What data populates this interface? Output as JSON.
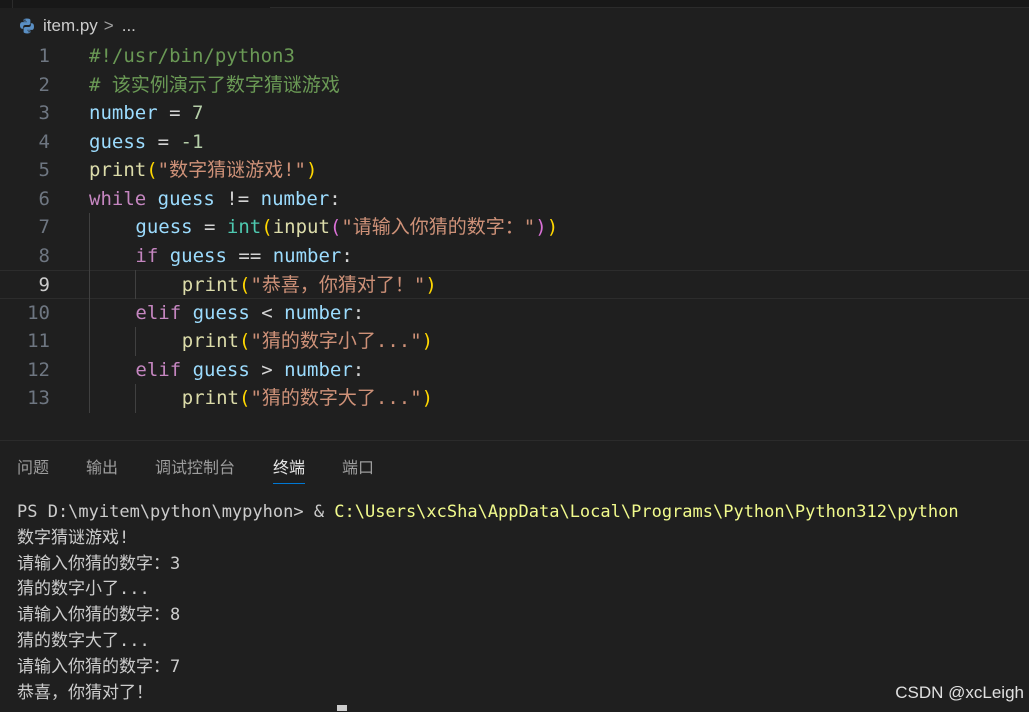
{
  "breadcrumb": {
    "file": "item.py",
    "chevron": ">",
    "ellipsis": "..."
  },
  "editor": {
    "active_line": 9,
    "lines": [
      {
        "n": "1",
        "indent": 0,
        "tokens": [
          {
            "t": "#!/usr/bin/python3",
            "c": "comment"
          }
        ]
      },
      {
        "n": "2",
        "indent": 0,
        "tokens": [
          {
            "t": "# 该实例演示了数字猜谜游戏",
            "c": "comment"
          }
        ]
      },
      {
        "n": "3",
        "indent": 0,
        "tokens": [
          {
            "t": "number",
            "c": "var"
          },
          {
            "t": " = ",
            "c": "op"
          },
          {
            "t": "7",
            "c": "num"
          }
        ]
      },
      {
        "n": "4",
        "indent": 0,
        "tokens": [
          {
            "t": "guess",
            "c": "var"
          },
          {
            "t": " = ",
            "c": "op"
          },
          {
            "t": "-1",
            "c": "num"
          }
        ]
      },
      {
        "n": "5",
        "indent": 0,
        "tokens": [
          {
            "t": "print",
            "c": "fn"
          },
          {
            "t": "(",
            "c": "p1"
          },
          {
            "t": "\"数字猜谜游戏!\"",
            "c": "str"
          },
          {
            "t": ")",
            "c": "p1"
          }
        ]
      },
      {
        "n": "6",
        "indent": 0,
        "tokens": [
          {
            "t": "while",
            "c": "kw"
          },
          {
            "t": " ",
            "c": "op"
          },
          {
            "t": "guess",
            "c": "var"
          },
          {
            "t": " != ",
            "c": "op"
          },
          {
            "t": "number",
            "c": "var"
          },
          {
            "t": ":",
            "c": "op"
          }
        ]
      },
      {
        "n": "7",
        "indent": 1,
        "tokens": [
          {
            "t": "guess",
            "c": "var"
          },
          {
            "t": " = ",
            "c": "op"
          },
          {
            "t": "int",
            "c": "type"
          },
          {
            "t": "(",
            "c": "p1"
          },
          {
            "t": "input",
            "c": "fn"
          },
          {
            "t": "(",
            "c": "p2"
          },
          {
            "t": "\"请输入你猜的数字：\"",
            "c": "str"
          },
          {
            "t": ")",
            "c": "p2"
          },
          {
            "t": ")",
            "c": "p1"
          }
        ]
      },
      {
        "n": "8",
        "indent": 1,
        "tokens": [
          {
            "t": "if",
            "c": "kw"
          },
          {
            "t": " ",
            "c": "op"
          },
          {
            "t": "guess",
            "c": "var"
          },
          {
            "t": " == ",
            "c": "op"
          },
          {
            "t": "number",
            "c": "var"
          },
          {
            "t": ":",
            "c": "op"
          }
        ]
      },
      {
        "n": "9",
        "indent": 2,
        "tokens": [
          {
            "t": "print",
            "c": "fn"
          },
          {
            "t": "(",
            "c": "p1"
          },
          {
            "t": "\"恭喜，你猜对了！\"",
            "c": "str"
          },
          {
            "t": ")",
            "c": "p1"
          }
        ]
      },
      {
        "n": "10",
        "indent": 1,
        "tokens": [
          {
            "t": "elif",
            "c": "kw"
          },
          {
            "t": " ",
            "c": "op"
          },
          {
            "t": "guess",
            "c": "var"
          },
          {
            "t": " < ",
            "c": "op"
          },
          {
            "t": "number",
            "c": "var"
          },
          {
            "t": ":",
            "c": "op"
          }
        ]
      },
      {
        "n": "11",
        "indent": 2,
        "tokens": [
          {
            "t": "print",
            "c": "fn"
          },
          {
            "t": "(",
            "c": "p1"
          },
          {
            "t": "\"猜的数字小了...\"",
            "c": "str"
          },
          {
            "t": ")",
            "c": "p1"
          }
        ]
      },
      {
        "n": "12",
        "indent": 1,
        "tokens": [
          {
            "t": "elif",
            "c": "kw"
          },
          {
            "t": " ",
            "c": "op"
          },
          {
            "t": "guess",
            "c": "var"
          },
          {
            "t": " > ",
            "c": "op"
          },
          {
            "t": "number",
            "c": "var"
          },
          {
            "t": ":",
            "c": "op"
          }
        ]
      },
      {
        "n": "13",
        "indent": 2,
        "tokens": [
          {
            "t": "print",
            "c": "fn"
          },
          {
            "t": "(",
            "c": "p1"
          },
          {
            "t": "\"猜的数字大了...\"",
            "c": "str"
          },
          {
            "t": ")",
            "c": "p1"
          }
        ]
      }
    ]
  },
  "panel": {
    "tabs": [
      "问题",
      "输出",
      "调试控制台",
      "终端",
      "端口"
    ],
    "active_tab": "终端"
  },
  "terminal": {
    "prompt": "PS D:\\myitem\\python\\mypyhon> ",
    "amp": "& ",
    "command": "C:\\Users\\xcSha\\AppData\\Local\\Programs\\Python\\Python312\\python",
    "output": [
      "数字猜谜游戏!",
      "请输入你猜的数字：3",
      "猜的数字小了...",
      "请输入你猜的数字：8",
      "猜的数字大了...",
      "请输入你猜的数字：7",
      "恭喜，你猜对了！"
    ]
  },
  "watermark": "CSDN @xcLeigh",
  "colors": {
    "background": "#1f1f1f",
    "comment": "#6a9955",
    "variable": "#9cdcfe",
    "keyword": "#c586c0",
    "function": "#dcdcaa",
    "string": "#ce9178",
    "number": "#b5cea8",
    "builtin_type": "#4ec9b0",
    "bracket_1": "#ffd700",
    "bracket_2": "#da70d6",
    "terminal_command": "#f1fa8c",
    "tab_active_underline": "#0078d4"
  }
}
